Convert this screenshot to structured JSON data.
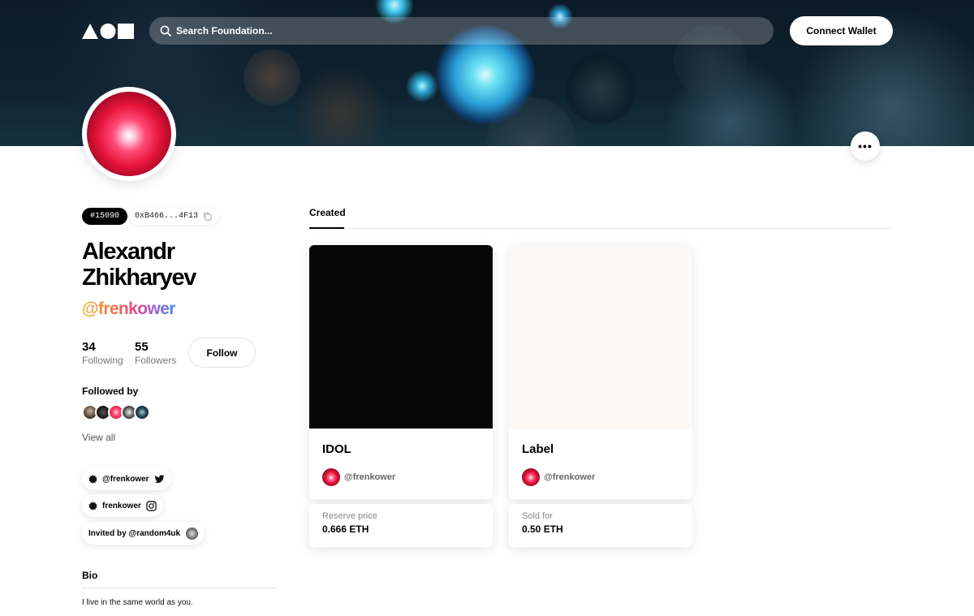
{
  "header": {
    "search_placeholder": "Search Foundation...",
    "connect_label": "Connect Wallet",
    "more_label": "•••"
  },
  "profile": {
    "id": "#15090",
    "address": "0xB466...4F13",
    "name": "Alexandr Zhikharyev",
    "handle": "@frenkower",
    "following_count": "34",
    "following_label": "Following",
    "followers_count": "55",
    "followers_label": "Followers",
    "follow_label": "Follow",
    "followed_by_label": "Followed by",
    "view_all_label": "View all"
  },
  "socials": [
    {
      "label": "@frenkower",
      "icon": "twitter-icon"
    },
    {
      "label": "frenkower",
      "icon": "instagram-icon"
    }
  ],
  "invited": {
    "label": "Invited by @random4uk"
  },
  "bio": {
    "label": "Bio",
    "text": "I live in the same world as you."
  },
  "tabs": [
    {
      "label": "Created",
      "active": true
    }
  ],
  "cards": [
    {
      "title": "IDOL",
      "creator": "@frenkower",
      "price_label": "Reserve price",
      "price": "0.666 ETH",
      "media_color": "#060606"
    },
    {
      "title": "Label",
      "creator": "@frenkower",
      "price_label": "Sold for",
      "price": "0.50 ETH",
      "media_color": "#fbf8f5"
    }
  ],
  "colors": {
    "accent": "#000000",
    "avatar_red": "#e5143c"
  }
}
